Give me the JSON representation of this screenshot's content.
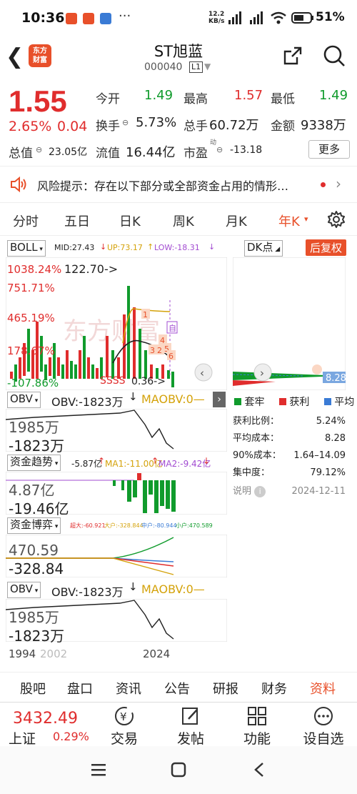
{
  "status_bar": {
    "time": "10:36",
    "dots": "···",
    "net_speed": "12.2",
    "net_unit": "KB/s",
    "battery": "51%"
  },
  "header": {
    "logo_line1": "东方",
    "logo_line2": "财富",
    "title": "ST旭蓝",
    "code": "000040",
    "level": "L1"
  },
  "quote": {
    "price": "1.55",
    "change_pct": "2.65%",
    "change": "0.04",
    "open_label": "今开",
    "open": "1.49",
    "high_label": "最高",
    "high": "1.57",
    "low_label": "最低",
    "low": "1.49",
    "turnover_label": "换手",
    "turnover": "5.73%",
    "volume_label": "总手",
    "volume": "60.72万",
    "amount_label": "金额",
    "amount": "9338万",
    "total_mv_label": "总值",
    "total_mv": "23.05亿",
    "float_mv_label": "流值",
    "float_mv": "16.44亿",
    "pe_label": "市盈",
    "pe_sup": "动",
    "pe": "-13.18",
    "more": "更多"
  },
  "risk": {
    "text": "风险提示：存在以下部分或全部资金占用的情形…"
  },
  "tabs": [
    "分时",
    "五日",
    "日K",
    "周K",
    "月K",
    "年K"
  ],
  "chart": {
    "indicator": "BOLL",
    "mid": "MID:27.43",
    "up": "UP:73.17",
    "low": "LOW:-18.31",
    "dk": "DK点",
    "fuquan": "后复权",
    "y_labels": [
      "1038.24%",
      "751.71%",
      "465.19%",
      "178.67%",
      "-107.86%"
    ],
    "price_note": "122.70->",
    "low_note": "0.36->",
    "ss_text": "SSSS",
    "watermark": "东方财富",
    "marker_self": "自",
    "markers": [
      "1",
      "2",
      "3",
      "4",
      "5",
      "6"
    ],
    "obv_label": "OBV",
    "obv_val": "OBV:-1823万",
    "maobv": "MAOBV:0—",
    "obv_hi": "1985万",
    "obv_lo": "-1823万",
    "zjqs_label": "资金趋势",
    "zjqs_val": "-5.87亿",
    "zjqs_ma1": "MA1:-11.00亿",
    "zjqs_ma2": "MA2:-9.42亿",
    "zjqs_hi": "4.87亿",
    "zjqs_lo": "-19.46亿",
    "zjby_label": "资金博弈",
    "zjby_big": "超大:-60.921",
    "zjby_large": "大户:-328.844",
    "zjby_mid": "中户:-80.944",
    "zjby_small": "小户:470.589",
    "zjby_hi": "470.59",
    "zjby_lo": "-328.84",
    "obv2_label": "OBV",
    "obv2_val": "OBV:-1823万",
    "obv2_ma": "MAOBV:0—",
    "obv2_hi": "1985万",
    "obv2_lo": "-1823万",
    "x_start": "1994",
    "x_mid": "2002",
    "x_end": "2024"
  },
  "chips": {
    "price_tag": "8.28",
    "legend": [
      "套牢",
      "获利",
      "平均"
    ],
    "rows": [
      {
        "label": "获利比例：",
        "value": "5.24%"
      },
      {
        "label": "平均成本：",
        "value": "8.28"
      },
      {
        "label": "90%成本：",
        "value": "1.64–14.09"
      },
      {
        "label": "集中度：",
        "value": "79.12%"
      }
    ],
    "note_label": "说明",
    "date": "2024-12-11"
  },
  "bottom_tabs": [
    "股吧",
    "盘口",
    "资讯",
    "公告",
    "研报",
    "财务",
    "资料"
  ],
  "footer": {
    "index_value": "3432.49",
    "index_name": "上证",
    "index_pct": "0.29%",
    "actions": [
      "交易",
      "发帖",
      "功能",
      "设自选"
    ]
  },
  "colors": {
    "up": "#e02d2d",
    "down": "#109b2c",
    "accent": "#e8502a"
  }
}
